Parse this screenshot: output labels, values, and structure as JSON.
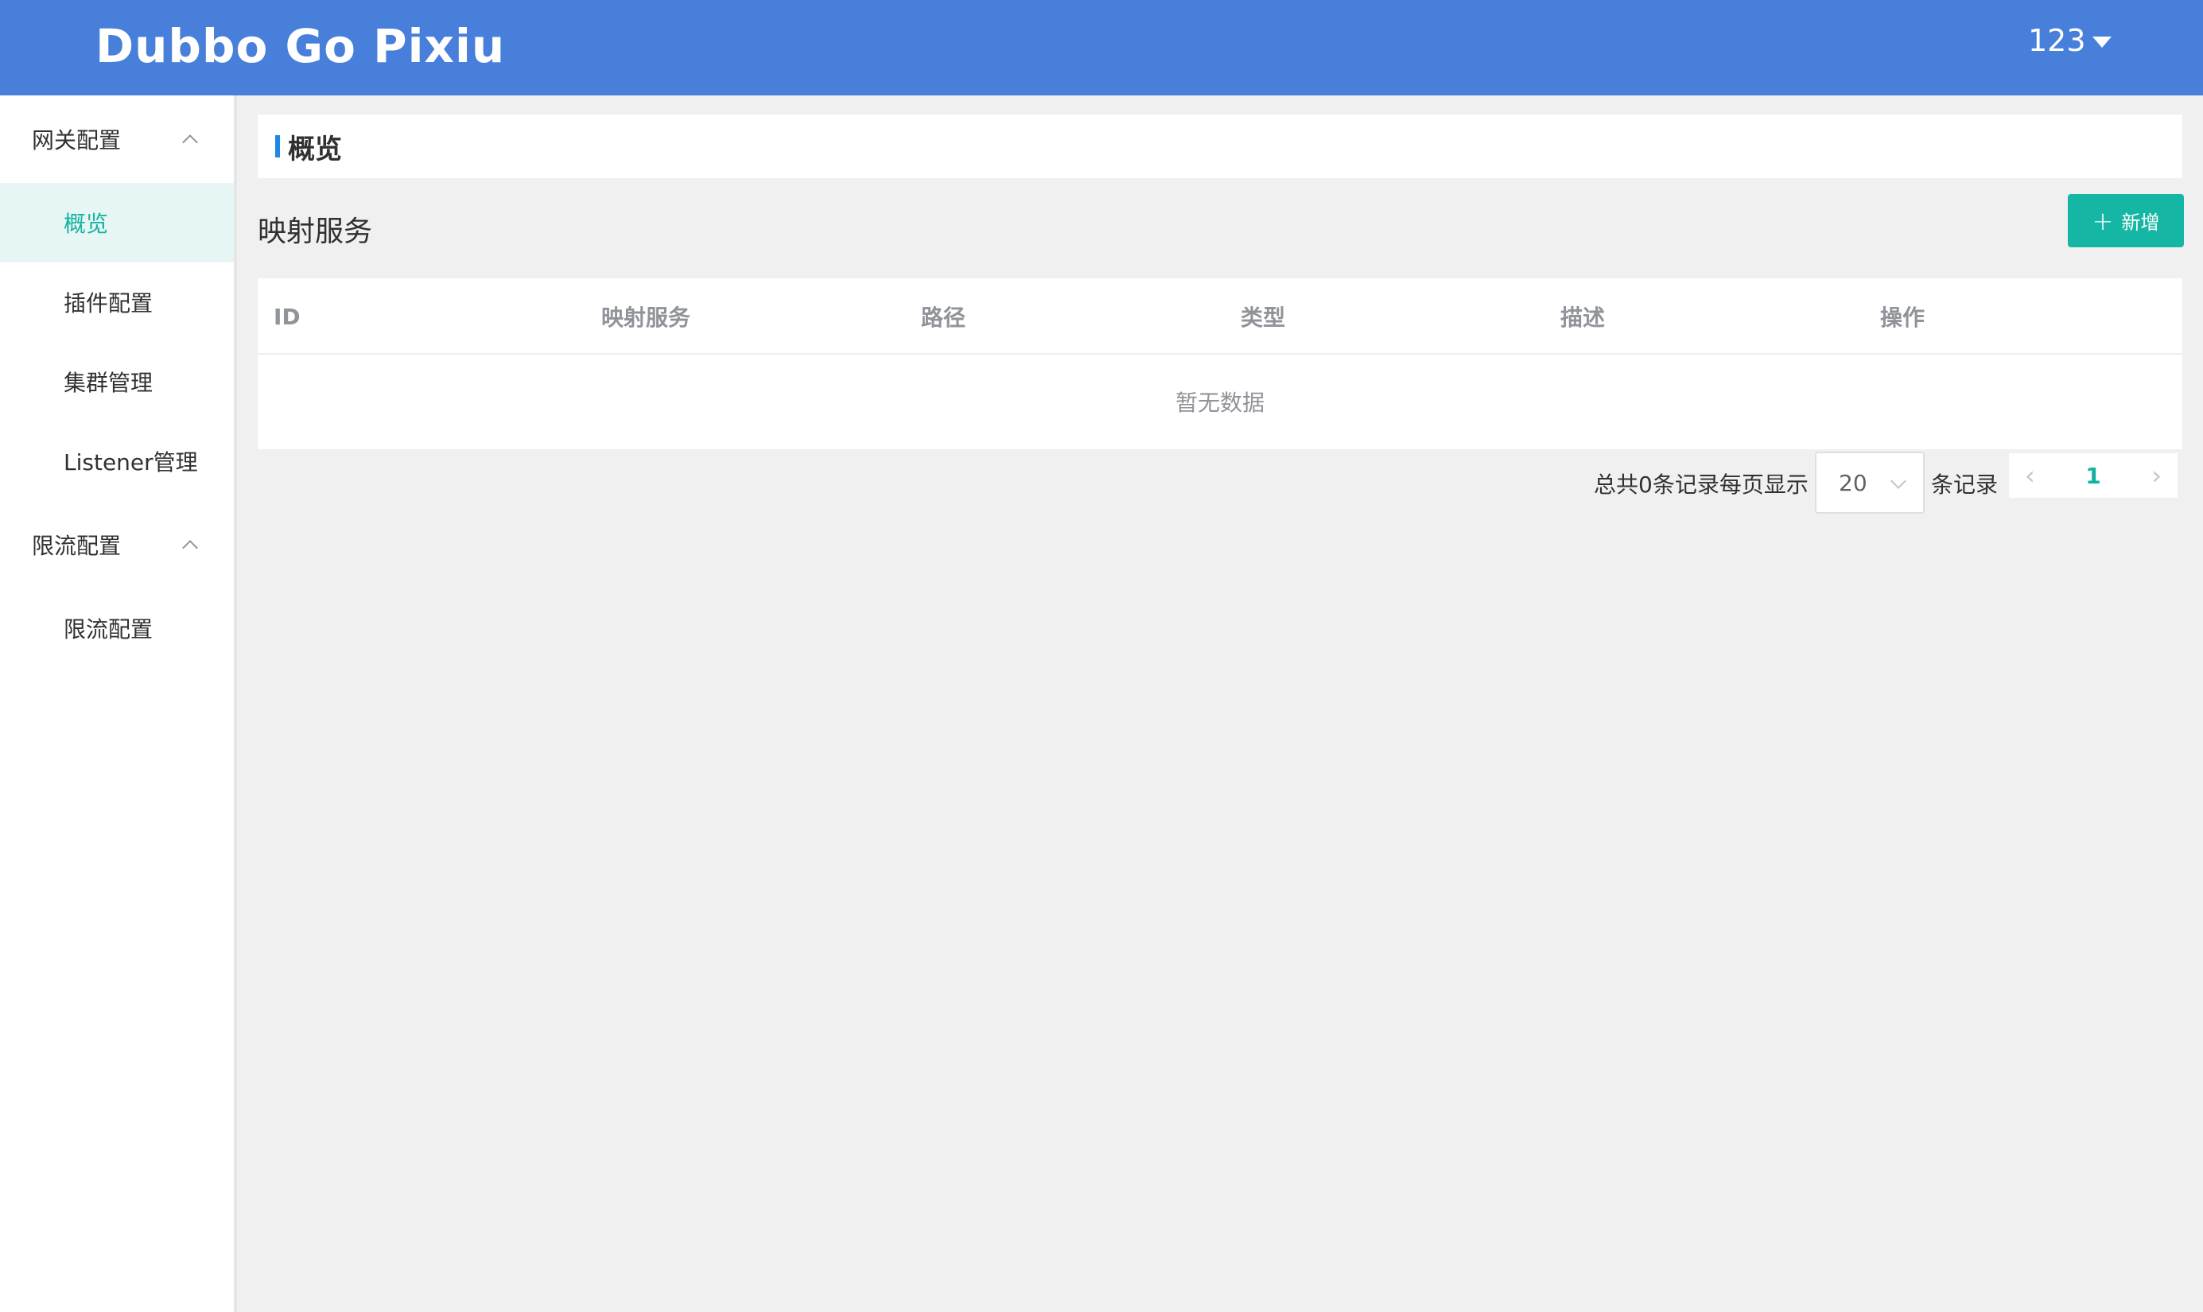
{
  "header": {
    "brand": "Dubbo Go Pixiu",
    "user": "123"
  },
  "sidebar": {
    "groups": [
      {
        "label": "网关配置",
        "items": [
          {
            "label": "概览",
            "active": true
          },
          {
            "label": "插件配置"
          },
          {
            "label": "集群管理"
          },
          {
            "label": "Listener管理"
          }
        ]
      },
      {
        "label": "限流配置",
        "items": [
          {
            "label": "限流配置"
          }
        ]
      }
    ]
  },
  "main": {
    "page_title": "概览",
    "section_title": "映射服务",
    "add_button": "新增",
    "table": {
      "columns": [
        "ID",
        "映射服务",
        "路径",
        "类型",
        "描述",
        "操作"
      ],
      "empty_text": "暂无数据"
    },
    "pagination": {
      "total_text": "总共0条记录每页显示",
      "page_size": "20",
      "suffix_text": "条记录",
      "current_page": "1"
    }
  },
  "colors": {
    "header": "#477fdb",
    "accent": "#15b7a4",
    "title_accent": "#1e88e5"
  }
}
